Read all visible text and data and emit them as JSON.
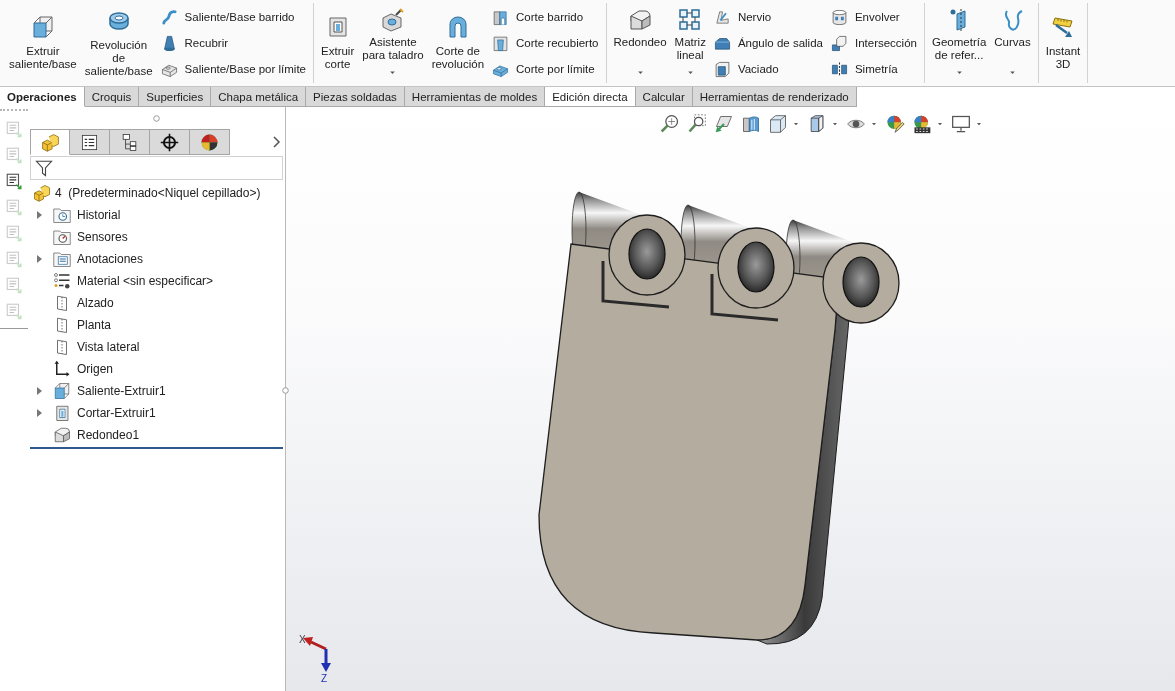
{
  "ribbon": {
    "groups": [
      {
        "buttons": [
          {
            "kind": "large",
            "lines": [
              "Extruir",
              "saliente/base"
            ],
            "dropdown": false
          },
          {
            "kind": "large",
            "lines": [
              "Revolución",
              "de",
              "saliente/base"
            ],
            "dropdown": false
          },
          {
            "kind": "stack",
            "items": [
              "Saliente/Base barrido",
              "Recubrir",
              "Saliente/Base por límite"
            ]
          }
        ]
      },
      {
        "buttons": [
          {
            "kind": "large",
            "lines": [
              "Extruir",
              "corte"
            ],
            "dropdown": false
          },
          {
            "kind": "large",
            "lines": [
              "Asistente",
              "para taladro"
            ],
            "dropdown": true
          },
          {
            "kind": "large",
            "lines": [
              "Corte de",
              "revolución"
            ],
            "dropdown": false
          },
          {
            "kind": "stack",
            "items": [
              "Corte barrido",
              "Corte recubierto",
              "Corte por límite"
            ]
          }
        ]
      },
      {
        "buttons": [
          {
            "kind": "large",
            "lines": [
              "Redondeo"
            ],
            "dropdown": true
          },
          {
            "kind": "large",
            "lines": [
              "Matriz",
              "lineal"
            ],
            "dropdown": true
          },
          {
            "kind": "stack",
            "items": [
              "Nervio",
              "Ángulo de salida",
              "Vaciado"
            ]
          },
          {
            "kind": "stack",
            "items": [
              "Envolver",
              "Intersección",
              "Simetría"
            ]
          }
        ]
      },
      {
        "buttons": [
          {
            "kind": "large",
            "lines": [
              "Geometría",
              "de refer..."
            ],
            "dropdown": true
          },
          {
            "kind": "large",
            "lines": [
              "Curvas"
            ],
            "dropdown": true
          }
        ]
      },
      {
        "buttons": [
          {
            "kind": "large",
            "lines": [
              "Instant",
              "3D"
            ],
            "dropdown": false
          }
        ]
      }
    ]
  },
  "tabs": [
    {
      "label": "Operaciones",
      "selected": true,
      "highlighted": false
    },
    {
      "label": "Croquis",
      "selected": false,
      "highlighted": false
    },
    {
      "label": "Superficies",
      "selected": false,
      "highlighted": false
    },
    {
      "label": "Chapa metálica",
      "selected": false,
      "highlighted": false
    },
    {
      "label": "Piezas soldadas",
      "selected": false,
      "highlighted": false
    },
    {
      "label": "Herramientas de moldes",
      "selected": false,
      "highlighted": false
    },
    {
      "label": "Edición directa",
      "selected": false,
      "highlighted": true
    },
    {
      "label": "Calcular",
      "selected": false,
      "highlighted": false
    },
    {
      "label": "Herramientas de renderizado",
      "selected": false,
      "highlighted": false
    }
  ],
  "side_toolbar": [
    {
      "disabled": true
    },
    {
      "disabled": true
    },
    {
      "disabled": false
    },
    {
      "disabled": true
    },
    {
      "disabled": true
    },
    {
      "disabled": true
    },
    {
      "disabled": true
    },
    {
      "disabled": true
    }
  ],
  "feature_manager": {
    "tabs": [
      {
        "selected": true
      },
      {
        "selected": false
      },
      {
        "selected": false
      },
      {
        "selected": false
      },
      {
        "selected": false
      }
    ],
    "tree": {
      "label": "4  (Predeterminado<Niquel cepillado>)",
      "children": [
        {
          "label": "Historial",
          "expandable": true
        },
        {
          "label": "Sensores",
          "expandable": false
        },
        {
          "label": "Anotaciones",
          "expandable": true
        },
        {
          "label": "Material <sin especificar>",
          "expandable": false
        },
        {
          "label": "Alzado",
          "expandable": false
        },
        {
          "label": "Planta",
          "expandable": false
        },
        {
          "label": "Vista lateral",
          "expandable": false
        },
        {
          "label": "Origen",
          "expandable": false
        },
        {
          "label": "Saliente-Extruir1",
          "expandable": true
        },
        {
          "label": "Cortar-Extruir1",
          "expandable": true
        },
        {
          "label": "Redondeo1",
          "expandable": false
        }
      ]
    }
  },
  "view_toolbar": [
    {
      "dropdown": false
    },
    {
      "dropdown": false
    },
    {
      "dropdown": false
    },
    {
      "dropdown": false
    },
    {
      "dropdown": true
    },
    {
      "dropdown": true
    },
    {
      "dropdown": true
    },
    {
      "dropdown": false
    },
    {
      "dropdown": true
    },
    {
      "dropdown": true
    }
  ],
  "triad": {
    "x_label": "X",
    "z_label": "Z"
  }
}
